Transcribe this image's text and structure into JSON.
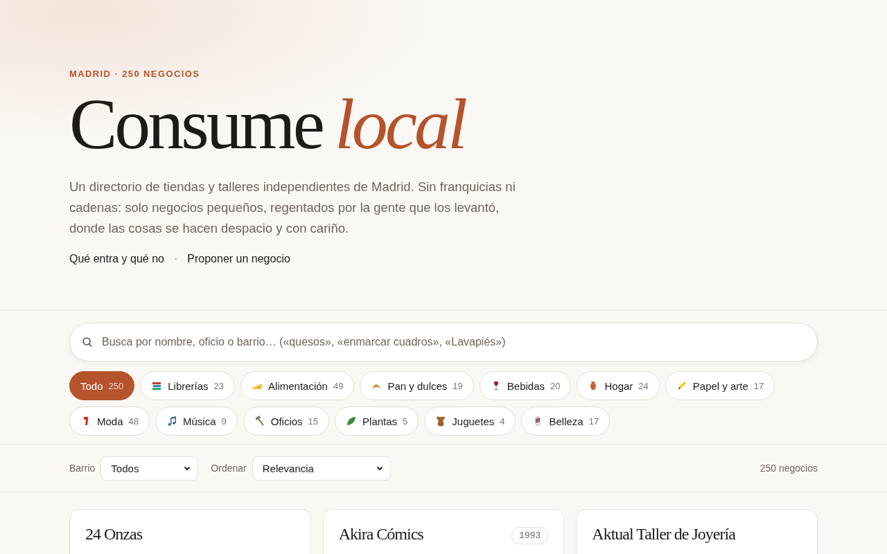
{
  "hero": {
    "eyebrow": "MADRID · 250 NEGOCIOS",
    "title": "Consume",
    "title_accent": "local",
    "intro": "Un directorio de tiendas y talleres independientes de Madrid. Sin franquicias ni cadenas: solo negocios pequeños, regentados por la gente que los levantó, donde las cosas se hacen despacio y con cariño.",
    "links": [
      "Qué entra y qué no",
      "Proponer un negocio"
    ],
    "separator": "·"
  },
  "search": {
    "placeholder": "Busca por nombre, oficio o barrio… («quesos», «enmarcar cuadros», «Lavapiés»)"
  },
  "categories": [
    {
      "label": "Todo",
      "count": "250",
      "selected": true
    },
    {
      "label": "Librerías",
      "count": "23",
      "selected": false,
      "kind": "books"
    },
    {
      "label": "Alimentación",
      "count": "49",
      "selected": false,
      "kind": "cheese"
    },
    {
      "label": "Pan y dulces",
      "count": "19",
      "selected": false,
      "kind": "croissant"
    },
    {
      "label": "Bebidas",
      "count": "20",
      "selected": false,
      "kind": "wine"
    },
    {
      "label": "Hogar",
      "count": "24",
      "selected": false,
      "kind": "vase"
    },
    {
      "label": "Papel y arte",
      "count": "17",
      "selected": false,
      "kind": "pencil"
    },
    {
      "label": "Moda",
      "count": "48",
      "selected": false,
      "kind": "scarf"
    },
    {
      "label": "Música",
      "count": "9",
      "selected": false,
      "kind": "note"
    },
    {
      "label": "Oficios",
      "count": "15",
      "selected": false,
      "kind": "hammer"
    },
    {
      "label": "Plantas",
      "count": "5",
      "selected": false,
      "kind": "leaf"
    },
    {
      "label": "Juguetes",
      "count": "4",
      "selected": false,
      "kind": "bear"
    },
    {
      "label": "Belleza",
      "count": "17",
      "selected": false,
      "kind": "pole"
    }
  ],
  "filters": [
    {
      "label": "Barrio",
      "value": "Todos"
    },
    {
      "label": "Ordenar",
      "value": "Relevancia"
    }
  ],
  "result_count": "250 negocios",
  "businesses": [
    {
      "name": "24 Onzas"
    },
    {
      "name": "Akira Cómics",
      "year": "1993"
    },
    {
      "name": "Aktual Taller de Joyería"
    }
  ]
}
